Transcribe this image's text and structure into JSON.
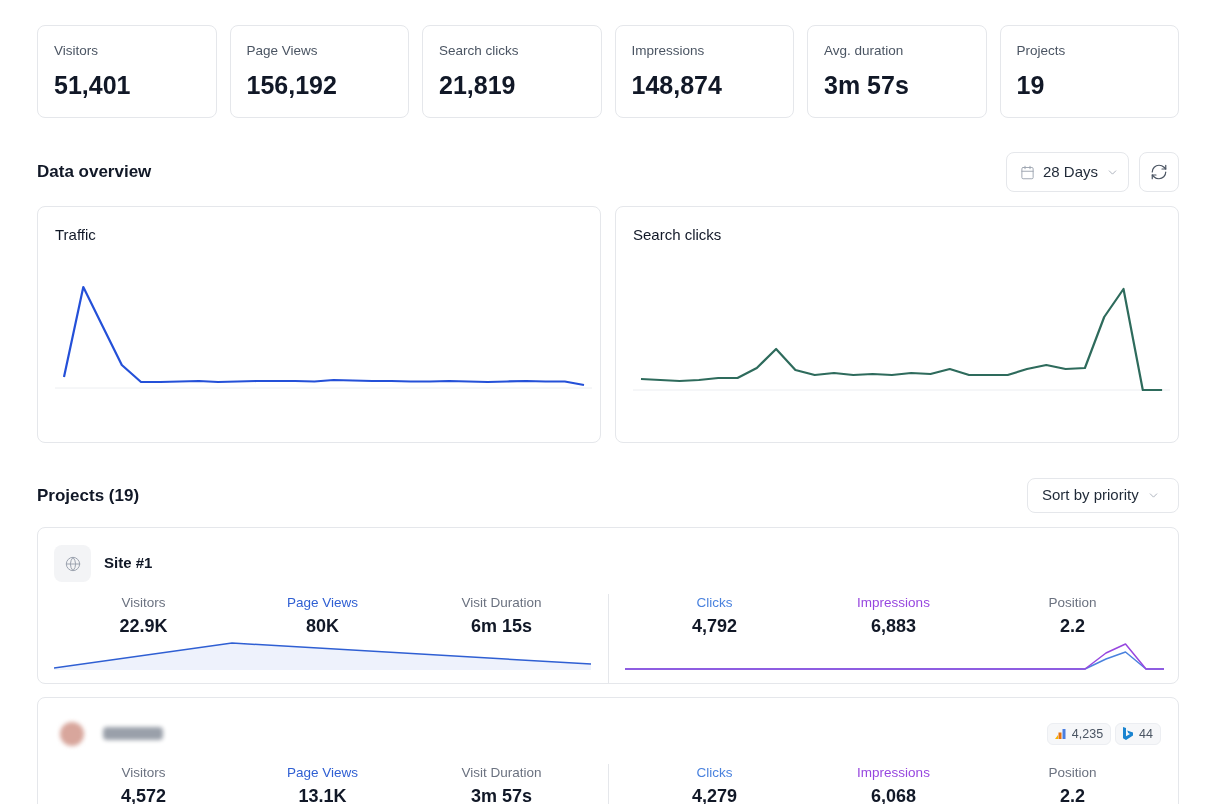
{
  "stats": [
    {
      "label": "Visitors",
      "value": "51,401"
    },
    {
      "label": "Page Views",
      "value": "156,192"
    },
    {
      "label": "Search clicks",
      "value": "21,819"
    },
    {
      "label": "Impressions",
      "value": "148,874"
    },
    {
      "label": "Avg. duration",
      "value": "3m 57s"
    },
    {
      "label": "Projects",
      "value": "19"
    }
  ],
  "overview": {
    "title": "Data overview",
    "range": "28 Days",
    "charts": [
      {
        "title": "Traffic",
        "kind": "traffic",
        "color": "#2450d8"
      },
      {
        "title": "Search clicks",
        "kind": "search",
        "color": "#2e6b5c"
      }
    ]
  },
  "projects": {
    "title": "Projects (19)",
    "sort": "Sort by priority",
    "items": [
      {
        "kind": "globe",
        "name": "Site #1",
        "site_metrics": [
          {
            "label": "Visitors",
            "value": "22.9K",
            "color": "#6b7280"
          },
          {
            "label": "Page Views",
            "value": "80K",
            "color": "#2f5fd3"
          },
          {
            "label": "Visit Duration",
            "value": "6m 15s",
            "color": "#6b7280"
          }
        ],
        "search_metrics": [
          {
            "label": "Clicks",
            "value": "4,792",
            "color": "#4a82de"
          },
          {
            "label": "Impressions",
            "value": "6,883",
            "color": "#9747df"
          },
          {
            "label": "Position",
            "value": "2.2",
            "color": "#6b7280"
          }
        ]
      },
      {
        "kind": "blurred",
        "badges": [
          {
            "kind": "analytics",
            "value": "4,235"
          },
          {
            "kind": "bing",
            "value": "44"
          }
        ],
        "site_metrics": [
          {
            "label": "Visitors",
            "value": "4,572",
            "color": "#6b7280"
          },
          {
            "label": "Page Views",
            "value": "13.1K",
            "color": "#2f5fd3"
          },
          {
            "label": "Visit Duration",
            "value": "3m 57s",
            "color": "#6b7280"
          }
        ],
        "search_metrics": [
          {
            "label": "Clicks",
            "value": "4,279",
            "color": "#4a82de"
          },
          {
            "label": "Impressions",
            "value": "6,068",
            "color": "#9747df"
          },
          {
            "label": "Position",
            "value": "2.2",
            "color": "#6b7280"
          }
        ]
      }
    ]
  }
}
